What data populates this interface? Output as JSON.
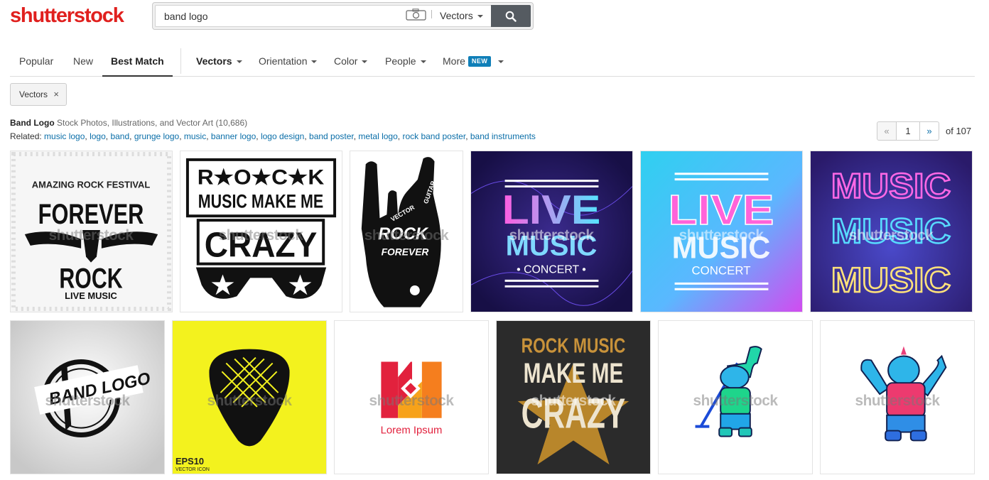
{
  "brand": {
    "logo_text": "shutterstock",
    "color": "#e0201e"
  },
  "search": {
    "query": "band logo",
    "type_selected": "Vectors",
    "camera_icon": "camera-icon",
    "search_icon": "magnifier-icon"
  },
  "nav": {
    "sort": [
      {
        "label": "Popular",
        "active": false
      },
      {
        "label": "New",
        "active": false
      },
      {
        "label": "Best Match",
        "active": true
      }
    ],
    "filters": [
      {
        "label": "Vectors"
      },
      {
        "label": "Orientation"
      },
      {
        "label": "Color"
      },
      {
        "label": "People"
      },
      {
        "label": "More",
        "badge": "NEW"
      }
    ]
  },
  "active_filters": [
    {
      "label": "Vectors",
      "remove": "×"
    }
  ],
  "results": {
    "title_bold": "Band Logo",
    "title_rest": " Stock Photos, Illustrations, and Vector Art (10,686)",
    "related_label": "Related:",
    "related": [
      "music logo",
      "logo",
      "band",
      "grunge logo",
      "music",
      "banner logo",
      "logo design",
      "band poster",
      "metal logo",
      "rock band poster",
      "band instruments"
    ]
  },
  "pagination": {
    "prev": "«",
    "page": "1",
    "next": "»",
    "of": "of 107"
  },
  "images": {
    "watermark": "shutterstock",
    "t1": {
      "l1": "AMAZING ROCK FESTIVAL",
      "l2": "FOREVER",
      "l3": "ROCK",
      "l4": "LIVE MUSIC"
    },
    "t2": {
      "l1": "R★O★C★K",
      "l2": "MUSIC MAKE ME",
      "l3": "CRAZY"
    },
    "t3": {
      "l1": "ROCK",
      "l2": "FOREVER",
      "l3": "VECTOR",
      "l4": "GUITAR"
    },
    "t4": {
      "l1": "LIVE",
      "l2": "MUSIC",
      "l3": "• CONCERT •"
    },
    "t5": {
      "l1": "LIVE",
      "l2": "MUSIC",
      "l3": "CONCERT"
    },
    "t6": {
      "l1": "MUSIC",
      "l2": "MUSIC",
      "l3": "MUSIC"
    },
    "t7": {
      "l1": "BAND LOGO"
    },
    "t8": {
      "l1": "EPS10",
      "l2": "VECTOR ICON"
    },
    "t9": {
      "l1": "Lorem Ipsum"
    },
    "t10": {
      "l1": "ROCK MUSIC",
      "l2": "MAKE ME",
      "l3": "CRAZY"
    },
    "t11": {},
    "t12": {}
  }
}
